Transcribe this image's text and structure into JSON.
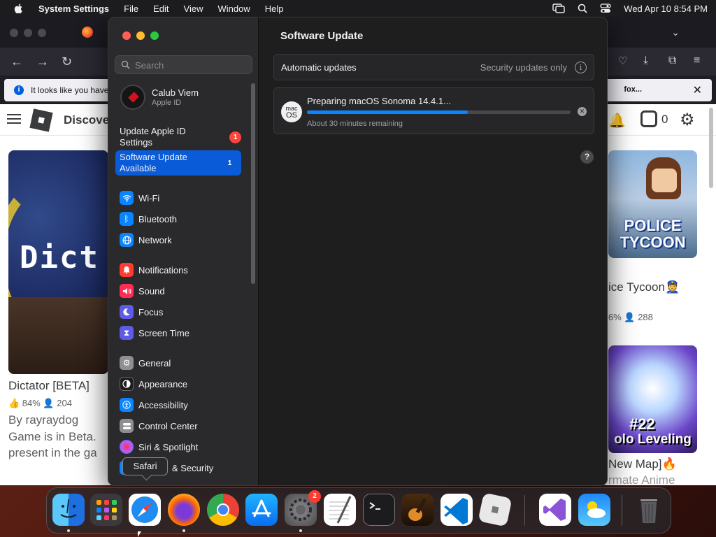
{
  "menubar": {
    "app_name": "System Settings",
    "items": [
      "File",
      "Edit",
      "View",
      "Window",
      "Help"
    ],
    "datetime": "Wed Apr 10  8:54 PM"
  },
  "browser": {
    "notice_text": "It looks like you have",
    "notice_right": "fox...",
    "roblox": {
      "discover": "Discove",
      "robux": "0",
      "card_left": {
        "image_text": "Dict",
        "title": "Dictator [BETA]",
        "stats": "👍 84%   👤 204",
        "by": "By rayraydog",
        "desc": "Game is in Beta. present in the ga"
      },
      "card_police": {
        "image_text": "POLICE TYCOON",
        "title": "ice Tycoon👮",
        "stats": "6%   👤 288"
      },
      "card_solo": {
        "image_num": "#22",
        "image_sub": "olo Leveling",
        "title": "New Map]🔥",
        "subtitle": "rmate Anime"
      }
    }
  },
  "settings": {
    "search_placeholder": "Search",
    "account": {
      "name": "Calub Viem",
      "sub": "Apple ID"
    },
    "promo_apple_id": {
      "label": "Update Apple ID Settings",
      "badge": "1"
    },
    "promo_update": {
      "label": "Software Update Available",
      "badge": "1"
    },
    "sidebar": [
      {
        "label": "Wi-Fi",
        "icon": "wifi-icon",
        "color": "#0a84ff"
      },
      {
        "label": "Bluetooth",
        "icon": "bluetooth-icon",
        "color": "#0a84ff"
      },
      {
        "label": "Network",
        "icon": "globe-icon",
        "color": "#0a84ff"
      },
      {
        "label": "Notifications",
        "icon": "bell-icon",
        "color": "#ff3b30"
      },
      {
        "label": "Sound",
        "icon": "speaker-icon",
        "color": "#ff2d55"
      },
      {
        "label": "Focus",
        "icon": "moon-icon",
        "color": "#5e5ce6"
      },
      {
        "label": "Screen Time",
        "icon": "hourglass-icon",
        "color": "#5e5ce6"
      },
      {
        "label": "General",
        "icon": "gear-icon",
        "color": "#8e8e93"
      },
      {
        "label": "Appearance",
        "icon": "appearance-icon",
        "color": "#1c1c1e"
      },
      {
        "label": "Accessibility",
        "icon": "accessibility-icon",
        "color": "#0a84ff"
      },
      {
        "label": "Control Center",
        "icon": "control-center-icon",
        "color": "#8e8e93"
      },
      {
        "label": "Siri & Spotlight",
        "icon": "siri-icon",
        "color": "#bf5af2"
      },
      {
        "label": "& Security",
        "icon": "privacy-icon",
        "color": "#0a84ff"
      }
    ],
    "tooltip": "Safari",
    "main": {
      "title": "Software Update",
      "auto_label": "Automatic updates",
      "auto_value": "Security updates only",
      "update_title": "Preparing macOS Sonoma 14.4.1...",
      "update_progress": 0.61,
      "update_remaining": "About 30 minutes remaining",
      "macos_icon_line1": "mac",
      "macos_icon_line2": "OS"
    }
  },
  "dock": {
    "settings_badge": "2",
    "apps": [
      "Finder",
      "Launchpad",
      "Safari",
      "Firefox",
      "Chrome",
      "App Store",
      "System Settings",
      "TextEdit",
      "Terminal",
      "GarageBand",
      "Visual Studio Code",
      "Roblox",
      "Visual Studio",
      "Weather",
      "Trash"
    ]
  }
}
